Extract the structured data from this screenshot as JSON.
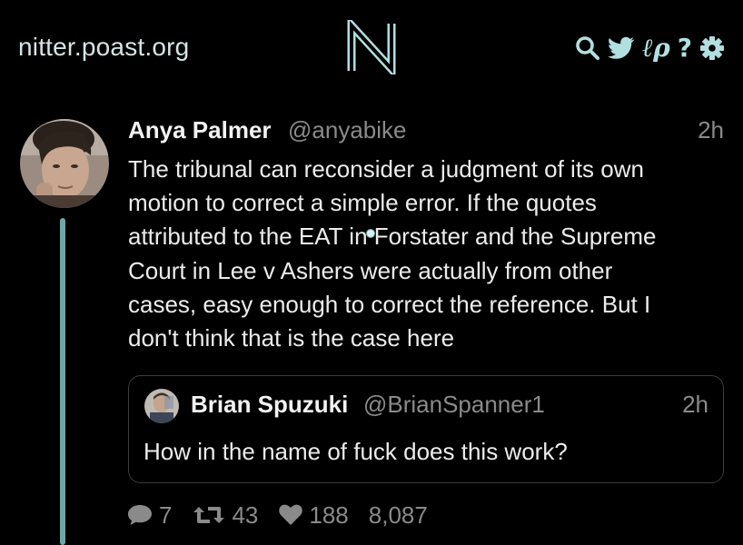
{
  "navbar": {
    "site_name": "nitter.poast.org",
    "logo_letter": "N",
    "rss_glyph": "ℓρ",
    "help_glyph": "?",
    "icons": [
      "search-icon",
      "twitter-bird-icon",
      "rss-icon",
      "help-icon",
      "gear-icon"
    ]
  },
  "tweet": {
    "fullname": "Anya Palmer",
    "username": "@anyabike",
    "date": "2h",
    "content": "The tribunal can reconsider a judgment of its own\nmotion to correct a simple error. If the quotes\nattributed to the EAT in Forstater and the Supreme\nCourt in Lee v Ashers were actually from other\ncases, easy enough to correct the reference. But I\ndon't think that is the case here",
    "quote": {
      "fullname": "Brian Spuzuki",
      "username": "@BrianSpanner1",
      "date": "2h",
      "text": "How in the name of fuck does this work?"
    },
    "stats": {
      "replies": "7",
      "retweets": "43",
      "likes": "188",
      "views": "8,087"
    }
  },
  "colors": {
    "background": "#000000",
    "accent": "#b2dfe0",
    "thread_line": "#6fa5a6",
    "muted": "#8a8a8a"
  }
}
